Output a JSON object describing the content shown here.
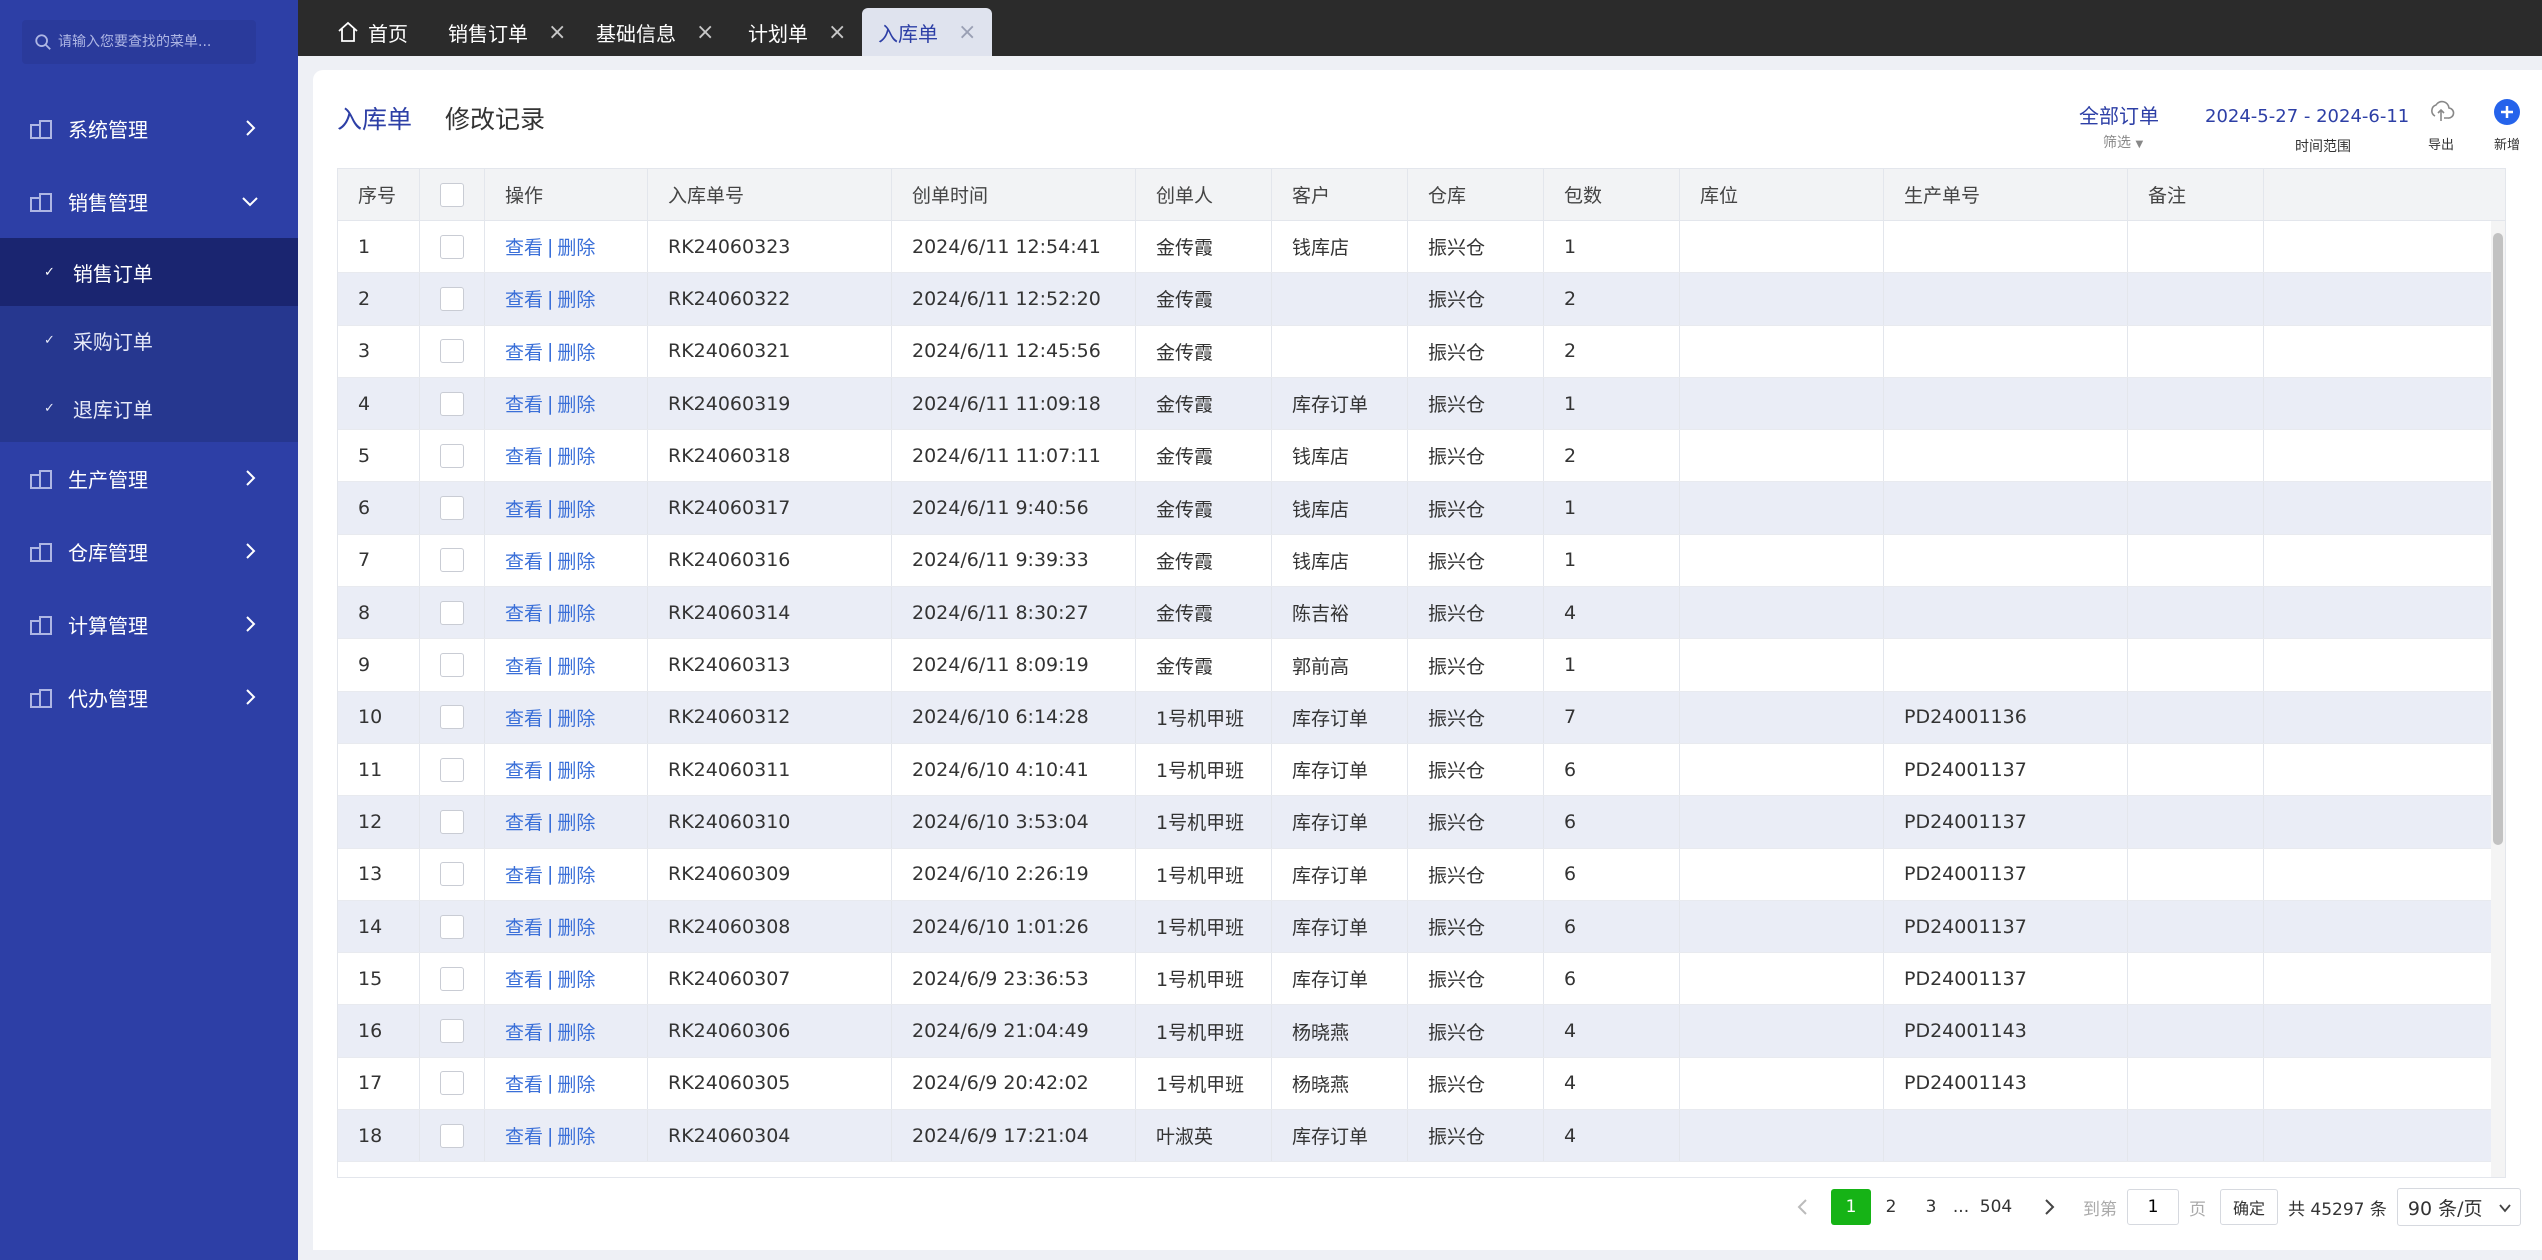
{
  "sidebar": {
    "search_placeholder": "请输入您要查找的菜单...",
    "items": [
      {
        "label": "系统管理"
      },
      {
        "label": "销售管理",
        "expanded": true
      },
      {
        "label": "生产管理"
      },
      {
        "label": "仓库管理"
      },
      {
        "label": "计算管理"
      },
      {
        "label": "代办管理"
      }
    ],
    "sub_items": [
      {
        "label": "销售订单",
        "active": true
      },
      {
        "label": "采购订单"
      },
      {
        "label": "退库订单"
      }
    ]
  },
  "tabs": [
    {
      "label": "首页",
      "icon": "home-icon"
    },
    {
      "label": "销售订单",
      "close": "×"
    },
    {
      "label": "基础信息",
      "close": "×"
    },
    {
      "label": "计划单",
      "close": "×"
    },
    {
      "label": "入库单",
      "close": "×",
      "active": true
    }
  ],
  "header": {
    "tab_active": "入库单",
    "tab_other": "修改记录",
    "filter_label": "全部订单",
    "filter_sub": "筛选",
    "date_range": "2024-5-27 - 2024-6-11",
    "date_label": "时间范围",
    "export_label": "导出",
    "add_label": "新增"
  },
  "table": {
    "columns": [
      "序号",
      "",
      "操作",
      "入库单号",
      "创单时间",
      "创单人",
      "客户",
      "仓库",
      "包数",
      "库位",
      "生产单号",
      "备注"
    ],
    "view_label": "查看",
    "delete_label": "删除",
    "rows": [
      [
        "1",
        "RK24060323",
        "2024/6/11 12:54:41",
        "金传霞",
        "钱库店",
        "振兴仓",
        "1",
        "",
        "",
        ""
      ],
      [
        "2",
        "RK24060322",
        "2024/6/11 12:52:20",
        "金传霞",
        "",
        "振兴仓",
        "2",
        "",
        "",
        ""
      ],
      [
        "3",
        "RK24060321",
        "2024/6/11 12:45:56",
        "金传霞",
        "",
        "振兴仓",
        "2",
        "",
        "",
        ""
      ],
      [
        "4",
        "RK24060319",
        "2024/6/11 11:09:18",
        "金传霞",
        "库存订单",
        "振兴仓",
        "1",
        "",
        "",
        ""
      ],
      [
        "5",
        "RK24060318",
        "2024/6/11 11:07:11",
        "金传霞",
        "钱库店",
        "振兴仓",
        "2",
        "",
        "",
        ""
      ],
      [
        "6",
        "RK24060317",
        "2024/6/11 9:40:56",
        "金传霞",
        "钱库店",
        "振兴仓",
        "1",
        "",
        "",
        ""
      ],
      [
        "7",
        "RK24060316",
        "2024/6/11 9:39:33",
        "金传霞",
        "钱库店",
        "振兴仓",
        "1",
        "",
        "",
        ""
      ],
      [
        "8",
        "RK24060314",
        "2024/6/11 8:30:27",
        "金传霞",
        "陈吉裕",
        "振兴仓",
        "4",
        "",
        "",
        ""
      ],
      [
        "9",
        "RK24060313",
        "2024/6/11 8:09:19",
        "金传霞",
        "郭前高",
        "振兴仓",
        "1",
        "",
        "",
        ""
      ],
      [
        "10",
        "RK24060312",
        "2024/6/10 6:14:28",
        "1号机甲班",
        "库存订单",
        "振兴仓",
        "7",
        "",
        "PD24001136",
        ""
      ],
      [
        "11",
        "RK24060311",
        "2024/6/10 4:10:41",
        "1号机甲班",
        "库存订单",
        "振兴仓",
        "6",
        "",
        "PD24001137",
        ""
      ],
      [
        "12",
        "RK24060310",
        "2024/6/10 3:53:04",
        "1号机甲班",
        "库存订单",
        "振兴仓",
        "6",
        "",
        "PD24001137",
        ""
      ],
      [
        "13",
        "RK24060309",
        "2024/6/10 2:26:19",
        "1号机甲班",
        "库存订单",
        "振兴仓",
        "6",
        "",
        "PD24001137",
        ""
      ],
      [
        "14",
        "RK24060308",
        "2024/6/10 1:01:26",
        "1号机甲班",
        "库存订单",
        "振兴仓",
        "6",
        "",
        "PD24001137",
        ""
      ],
      [
        "15",
        "RK24060307",
        "2024/6/9 23:36:53",
        "1号机甲班",
        "库存订单",
        "振兴仓",
        "6",
        "",
        "PD24001137",
        ""
      ],
      [
        "16",
        "RK24060306",
        "2024/6/9 21:04:49",
        "1号机甲班",
        "杨晓燕",
        "振兴仓",
        "4",
        "",
        "PD24001143",
        ""
      ],
      [
        "17",
        "RK24060305",
        "2024/6/9 20:42:02",
        "1号机甲班",
        "杨晓燕",
        "振兴仓",
        "4",
        "",
        "PD24001143",
        ""
      ],
      [
        "18",
        "RK24060304",
        "2024/6/9 17:21:04",
        "叶淑英",
        "库存订单",
        "振兴仓",
        "4",
        "",
        "",
        ""
      ]
    ]
  },
  "pagination": {
    "pages": [
      "1",
      "2",
      "3"
    ],
    "ellipsis": "...",
    "last_page": "504",
    "goto_label": "到第",
    "goto_value": "1",
    "page_unit": "页",
    "confirm_label": "确定",
    "total_text": "共 45297 条",
    "page_size": "90 条/页"
  },
  "colors": {
    "sidebar": "#2d3fa6",
    "accent": "#2d3fa6",
    "link": "#3a6fd8",
    "active_page": "#16b316",
    "tabbar": "#2b2b2b"
  }
}
